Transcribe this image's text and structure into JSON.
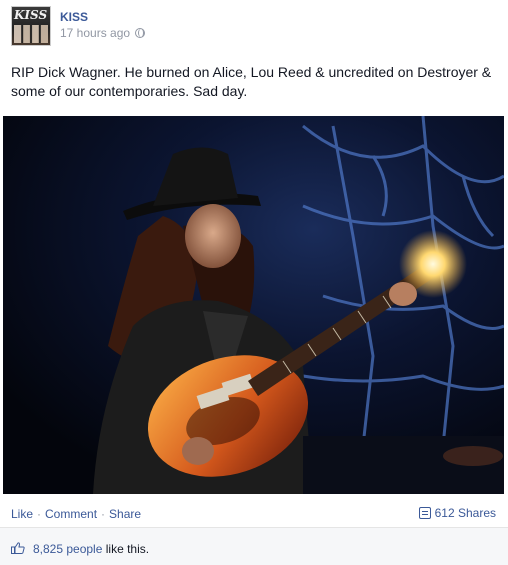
{
  "post": {
    "page_name": "KISS",
    "avatar_logo": "KISS",
    "timestamp": "17 hours ago",
    "privacy_icon": "globe-icon",
    "message": "RIP Dick Wagner. He burned on Alice, Lou Reed & uncredited on Destroyer & some of our contemporaries. Sad day.",
    "photo_description_icon": "photo"
  },
  "actions": {
    "like_label": "Like",
    "comment_label": "Comment",
    "share_label": "Share",
    "separator": "·",
    "shares_count": "612 Shares"
  },
  "likes": {
    "icon": "thumbs-up-icon",
    "count_label": "8,825 people",
    "suffix": " like this."
  },
  "colors": {
    "link": "#3b5998",
    "meta": "#9197a3",
    "text": "#141823",
    "footer_bg": "#f6f7f9"
  }
}
